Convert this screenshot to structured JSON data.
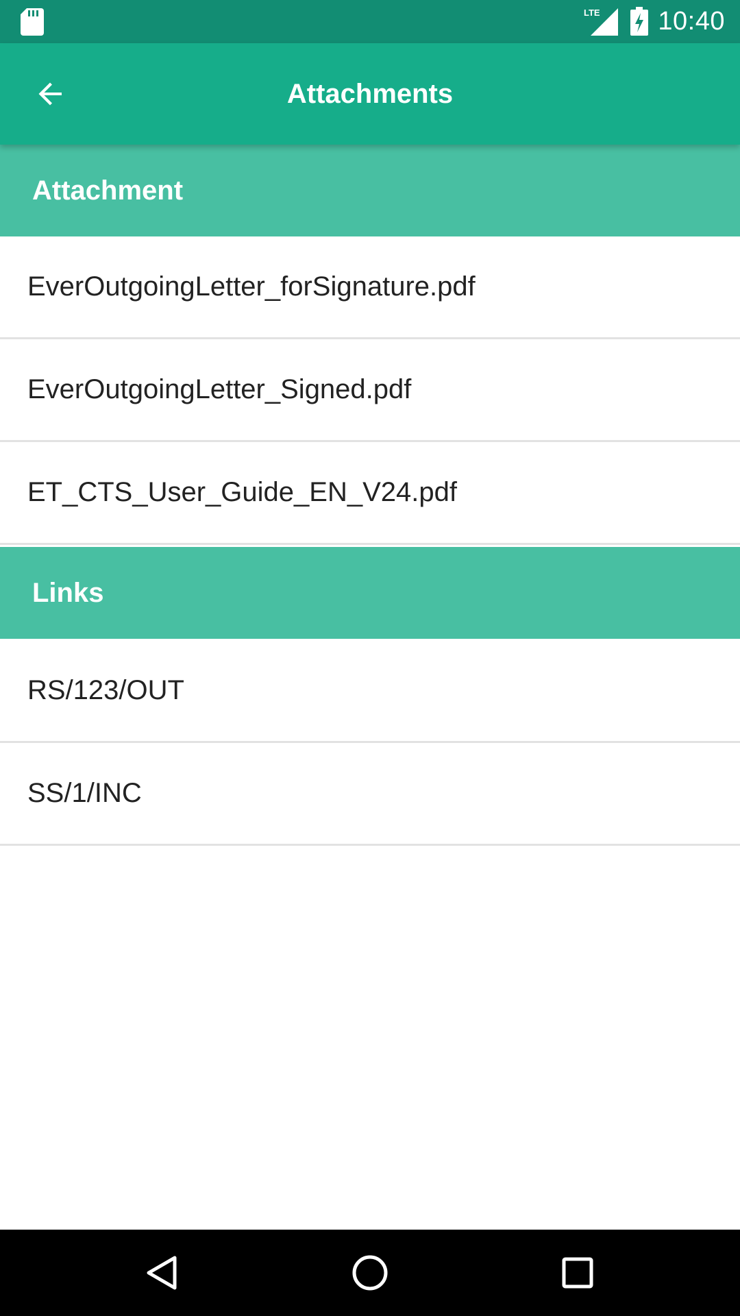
{
  "status_bar": {
    "time": "10:40",
    "icons": [
      "sd-card-icon",
      "lte-signal-icon",
      "battery-charging-icon"
    ]
  },
  "app_bar": {
    "title": "Attachments",
    "back_icon": "arrow-back-icon"
  },
  "sections": {
    "attachments": {
      "header": "Attachment",
      "items": [
        "EverOutgoingLetter_forSignature.pdf",
        "EverOutgoingLetter_Signed.pdf",
        "ET_CTS_User_Guide_EN_V24.pdf"
      ]
    },
    "links": {
      "header": "Links",
      "items": [
        "RS/123/OUT",
        "SS/1/INC"
      ]
    }
  },
  "nav_bar": {
    "icons": [
      "back-triangle-icon",
      "home-circle-icon",
      "recents-square-icon"
    ]
  },
  "colors": {
    "status_bar": "#128d73",
    "app_bar": "#16ad8a",
    "section_header": "#48bfa2",
    "divider": "#e2e2e2",
    "text": "#222222"
  }
}
